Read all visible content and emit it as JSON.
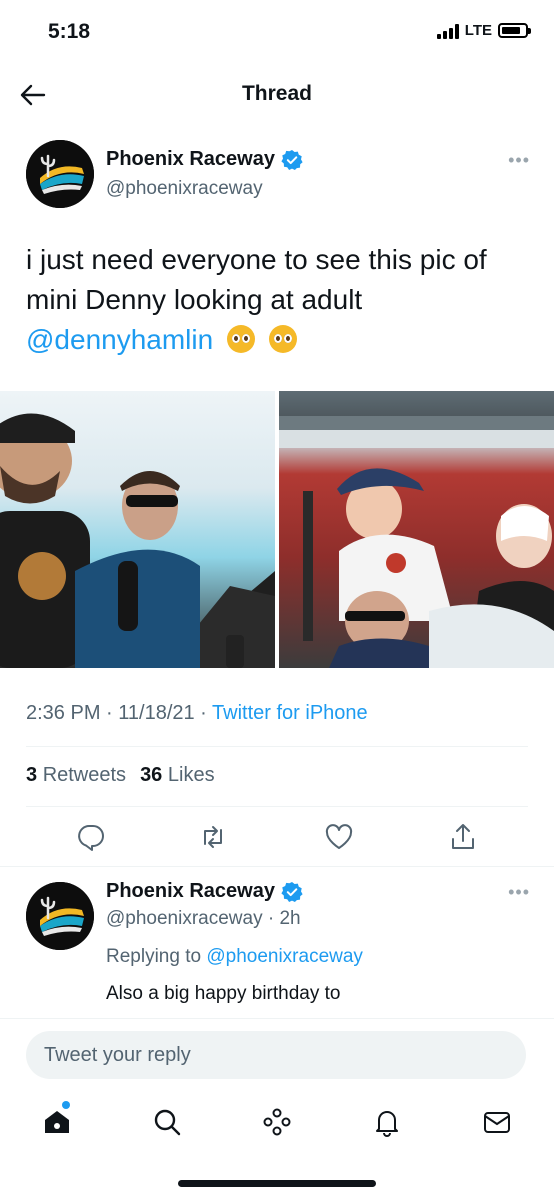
{
  "status_bar": {
    "time": "5:18",
    "network": "LTE",
    "battery_level": 0.8
  },
  "header": {
    "title": "Thread"
  },
  "main_tweet": {
    "author_name": "Phoenix Raceway",
    "author_handle": "@phoenixraceway",
    "text_part1": "i just need everyone to see this pic of mini Denny looking at adult",
    "mention": "@dennyhamlin",
    "timestamp": "2:36 PM · 11/18/21 · ",
    "source": "Twitter for iPhone",
    "retweets_count": "3",
    "retweets_label": "Retweets",
    "likes_count": "36",
    "likes_label": "Likes"
  },
  "reply_tweet": {
    "author_name": "Phoenix Raceway",
    "author_handle": "@phoenixraceway · 2h",
    "replying_prefix": "Replying to ",
    "replying_to": "@phoenixraceway",
    "text": "Also a big happy birthday to"
  },
  "compose": {
    "placeholder": "Tweet your reply"
  },
  "icons": {
    "back": "arrow-left-icon",
    "verified": "verified-badge-icon",
    "reply": "reply-icon",
    "retweet": "retweet-icon",
    "like": "heart-icon",
    "share": "share-icon",
    "home": "home-icon",
    "search": "search-icon",
    "spaces": "spaces-icon",
    "notifications": "bell-icon",
    "messages": "mail-icon"
  },
  "colors": {
    "accent": "#1d9bf0",
    "text": "#0f1419",
    "secondary": "#536471"
  }
}
